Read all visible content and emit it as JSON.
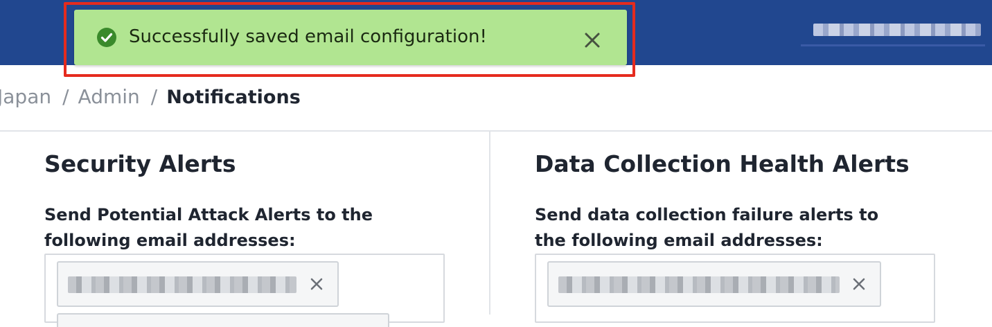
{
  "toast": {
    "message": "Successfully saved email configuration!",
    "success_color": "#b1e591",
    "icon": "check-circle-icon",
    "close_icon": "close-icon"
  },
  "header": {
    "background_color": "#21478f"
  },
  "breadcrumb": {
    "items": [
      "Japan",
      "Admin"
    ],
    "separator": "/",
    "current": "Notifications"
  },
  "security_alerts": {
    "title": "Security Alerts",
    "label": "Send Potential Attack Alerts to the following email addresses:"
  },
  "data_collection_alerts": {
    "title": "Data Collection Health Alerts",
    "label": "Send data collection failure alerts to the following email addresses:"
  },
  "annotation": {
    "highlight_color": "#e52b1e"
  }
}
